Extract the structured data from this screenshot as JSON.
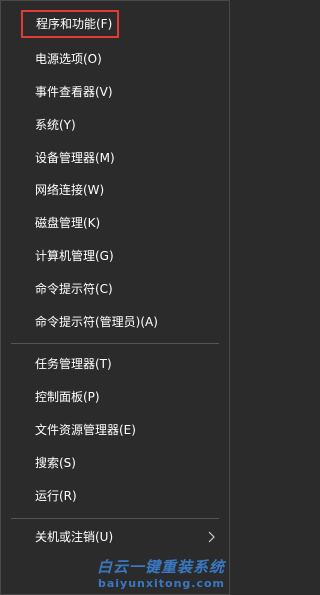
{
  "menu": {
    "items": [
      {
        "label": "程序和功能(F)",
        "highlighted": true
      },
      {
        "label": "电源选项(O)"
      },
      {
        "label": "事件查看器(V)"
      },
      {
        "label": "系统(Y)"
      },
      {
        "label": "设备管理器(M)"
      },
      {
        "label": "网络连接(W)"
      },
      {
        "label": "磁盘管理(K)"
      },
      {
        "label": "计算机管理(G)"
      },
      {
        "label": "命令提示符(C)"
      },
      {
        "label": "命令提示符(管理员)(A)"
      },
      {
        "label": "任务管理器(T)"
      },
      {
        "label": "控制面板(P)"
      },
      {
        "label": "文件资源管理器(E)"
      },
      {
        "label": "搜索(S)"
      },
      {
        "label": "运行(R)"
      },
      {
        "label": "关机或注销(U)",
        "has_submenu": true
      }
    ],
    "highlight_color": "#e53935",
    "background_color": "#2b2b2b",
    "submenu_icon": "chevron-right-icon"
  },
  "watermark": {
    "logo_text": "白云一键重装系统",
    "url": "baiyunxitong.com",
    "color": "#3a78c3"
  }
}
